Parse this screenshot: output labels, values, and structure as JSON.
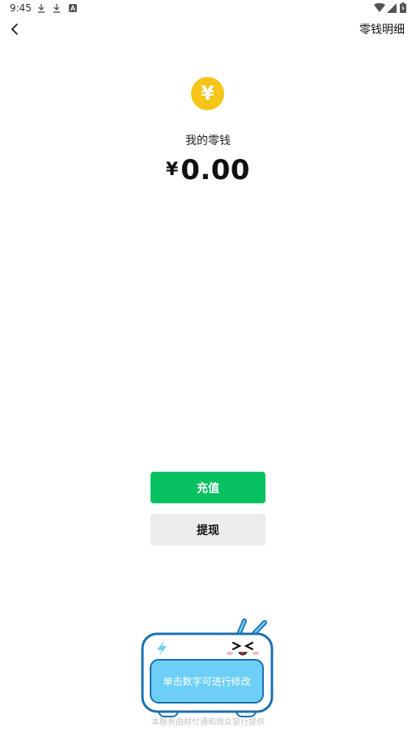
{
  "status_bar": {
    "time": "9:45",
    "icons": [
      "download-icon",
      "download-icon",
      "notification-a-icon",
      "wifi-icon",
      "signal-icon",
      "battery-icon"
    ]
  },
  "header": {
    "back_icon": "chevron-left-icon",
    "details_label": "零钱明细"
  },
  "wallet": {
    "coin_symbol": "¥",
    "label": "我的零钱",
    "currency": "¥",
    "amount": "0.00"
  },
  "actions": {
    "recharge_label": "充值",
    "withdraw_label": "提现"
  },
  "mascot": {
    "tip": "单击数字可进行修改"
  },
  "footer": {
    "note": "本服务由财付通和微众银行提供"
  },
  "colors": {
    "coin": "#f5c518",
    "primary_green": "#07c160",
    "secondary_gray": "#ececec",
    "mascot_blue": "#6ecff6",
    "mascot_outline": "#1a6fb0"
  }
}
